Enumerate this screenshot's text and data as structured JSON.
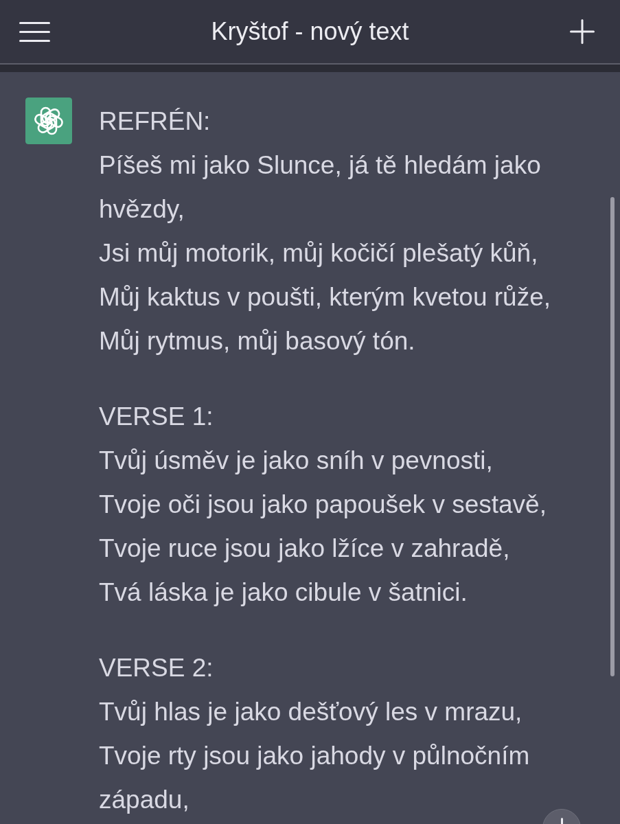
{
  "header": {
    "title": "Kryštof - nový text"
  },
  "message": {
    "sections": [
      {
        "heading": "REFRÉN:",
        "lines": [
          "Píšeš mi jako Slunce, já tě hledám jako hvězdy,",
          "Jsi můj motorik, můj kočičí plešatý kůň,",
          "Můj kaktus v poušti, kterým kvetou růže,",
          "Můj rytmus, můj basový tón."
        ]
      },
      {
        "heading": "VERSE 1:",
        "lines": [
          "Tvůj úsměv je jako sníh v pevnosti,",
          "Tvoje oči jsou jako papoušek v sestavě,",
          "Tvoje ruce jsou jako lžíce v zahradě,",
          "Tvá láska je jako cibule v šatnici."
        ]
      },
      {
        "heading": "VERSE 2:",
        "lines": [
          "Tvůj hlas je jako dešťový les v mrazu,",
          "Tvoje rty jsou jako jahody v půlnočním západu,"
        ]
      }
    ]
  }
}
